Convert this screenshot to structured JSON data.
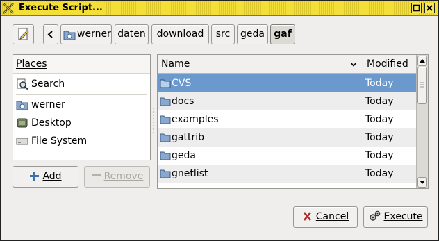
{
  "window": {
    "title": "Execute Script...",
    "controls": [
      "maximize-icon",
      "close-icon"
    ]
  },
  "pathbar": {
    "back_icon": "chevron-left-icon",
    "crumbs": [
      "werner",
      "daten",
      "download",
      "src",
      "geda",
      "gaf"
    ],
    "active_crumb": "gaf"
  },
  "places": {
    "header": "Places",
    "items": [
      {
        "label": "Search",
        "icon": "search-icon"
      },
      {
        "label": "werner",
        "icon": "home-folder-icon"
      },
      {
        "label": "Desktop",
        "icon": "desktop-icon"
      },
      {
        "label": "File System",
        "icon": "drive-icon"
      }
    ],
    "add_label": "Add",
    "remove_label": "Remove"
  },
  "files": {
    "columns": {
      "name": "Name",
      "modified": "Modified"
    },
    "rows": [
      {
        "name": "CVS",
        "modified": "Today"
      },
      {
        "name": "docs",
        "modified": "Today"
      },
      {
        "name": "examples",
        "modified": "Today"
      },
      {
        "name": "gattrib",
        "modified": "Today"
      },
      {
        "name": "geda",
        "modified": "Today"
      },
      {
        "name": "gnetlist",
        "modified": "Today"
      }
    ],
    "selected_row": 0
  },
  "actions": {
    "cancel_label": "Cancel",
    "execute_label": "Execute"
  },
  "colors": {
    "titlebar": "#f3df38",
    "selection": "#6b99cd",
    "folder": "#8aa7cc"
  }
}
